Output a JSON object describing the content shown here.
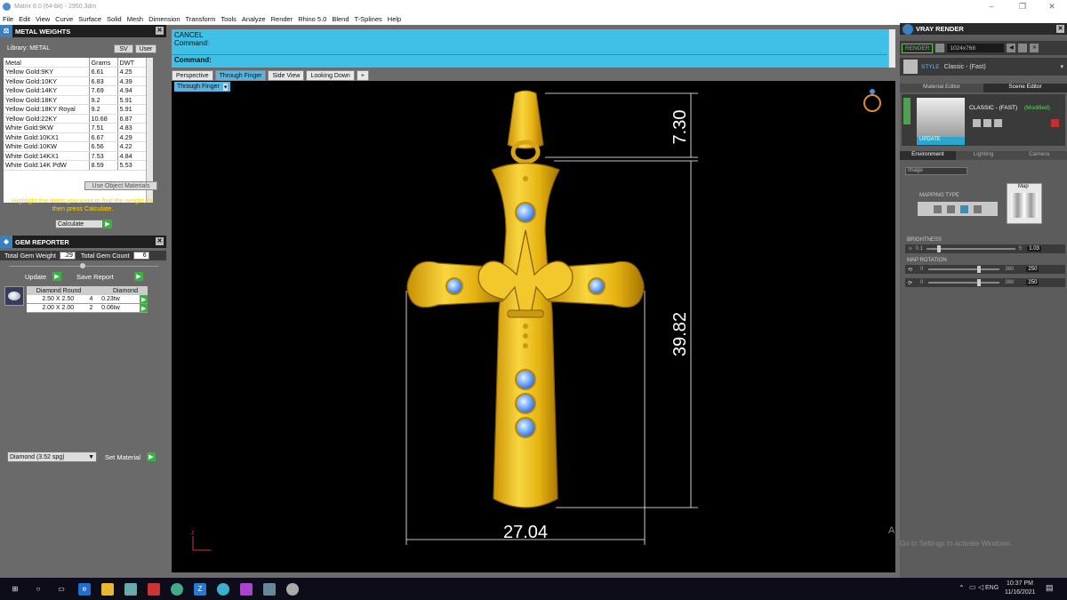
{
  "window": {
    "title": "Matrix 8.0 (64-bit) - 2950.3dm",
    "min": "–",
    "max": "❐",
    "close": "✕"
  },
  "menu": [
    "File",
    "Edit",
    "View",
    "Curve",
    "Surface",
    "Solid",
    "Mesh",
    "Dimension",
    "Transform",
    "Tools",
    "Analyze",
    "Render",
    "Rhino 5.0",
    "Blend",
    "T-Splines",
    "Help"
  ],
  "metal_weights": {
    "title": "METAL WEIGHTS",
    "library": "Library: METAL",
    "sv": "SV",
    "user": "User",
    "headers": [
      "Metal",
      "Grams",
      "DWT"
    ],
    "rows": [
      [
        "Yellow Gold:9KY",
        "6.61",
        "4.25"
      ],
      [
        "Yellow Gold:10KY",
        "6.83",
        "4.39"
      ],
      [
        "Yellow Gold:14KY",
        "7.69",
        "4.94"
      ],
      [
        "Yellow Gold:18KY",
        "9.2",
        "5.91"
      ],
      [
        "Yellow Gold:18KY Royal",
        "9.2",
        "5.91"
      ],
      [
        "Yellow Gold:22KY",
        "10.68",
        "6.87"
      ],
      [
        "White Gold:9KW",
        "7.51",
        "4.83"
      ],
      [
        "White Gold:10KX1",
        "6.67",
        "4.29"
      ],
      [
        "White Gold:10KW",
        "6.56",
        "4.22"
      ],
      [
        "White Gold:14KX1",
        "7.53",
        "4.84"
      ],
      [
        "White Gold:14K PdW",
        "8.59",
        "5.53"
      ]
    ],
    "use_object_materials": "Use Object Materials",
    "hint": "Highlight the items you want to find the weight for then press Calculate.",
    "calculate": "Calculate"
  },
  "gem_reporter": {
    "title": "GEM REPORTER",
    "total_weight_label": "Total Gem Weight",
    "total_weight": ".29",
    "total_count_label": "Total Gem Count",
    "total_count": "6",
    "update": "Update",
    "save_report": "Save Report",
    "headers": [
      "Diamond Round",
      "",
      "Diamond"
    ],
    "rows": [
      [
        "2.50 X 2.50",
        "4",
        "0.23tw"
      ],
      [
        "2.00 X 2.00",
        "2",
        "0.06tw"
      ]
    ],
    "material_select": "Diamond    (3.52 spg)",
    "set_material": "Set Material"
  },
  "command": {
    "cancel": "CANCEL",
    "line2": "Command:",
    "prompt": "Command:"
  },
  "tabs": [
    "Perspective",
    "Through Finger",
    "Side View",
    "Looking Down",
    "+"
  ],
  "active_tab": 1,
  "viewport": {
    "label": "Through Finger",
    "dim_top": "7.30",
    "dim_height": "39.82",
    "dim_width": "27.04",
    "axis_label": "z",
    "watermark_title": "Activate Windows",
    "watermark_sub": "Go to Settings to activate Windows.",
    "colors": {
      "gold": "#e8b81c",
      "gold_dark": "#b58300",
      "gem": "#7fb2ff",
      "bg": "#000000"
    }
  },
  "vray": {
    "title": "VRAY RENDER",
    "render": "RENDER",
    "resolution": "1024x768",
    "style_label": "STYLE",
    "style": "Classic - (Fast)",
    "tabs": [
      "Material Editor",
      "Scene Editor"
    ],
    "preset_name": "CLASSIC - (FAST)",
    "modified": "(Modified)",
    "update": "UPDATE",
    "env_tabs": [
      "Environment",
      "Lighting",
      "Camera"
    ],
    "env_select": "Image",
    "mapping_type": "MAPPING TYPE",
    "map": "Map",
    "brightness": "BRIGHTNESS",
    "brightness_min": "0.1",
    "brightness_max": "5",
    "brightness_val": "1.03",
    "map_rotation": "MAP ROTATION",
    "rot_min": "0",
    "rot_max": "360",
    "rot1": "250",
    "rot2": "250"
  },
  "taskbar": {
    "lang": "ENG",
    "time": "10:37 PM",
    "date": "11/16/2021"
  }
}
